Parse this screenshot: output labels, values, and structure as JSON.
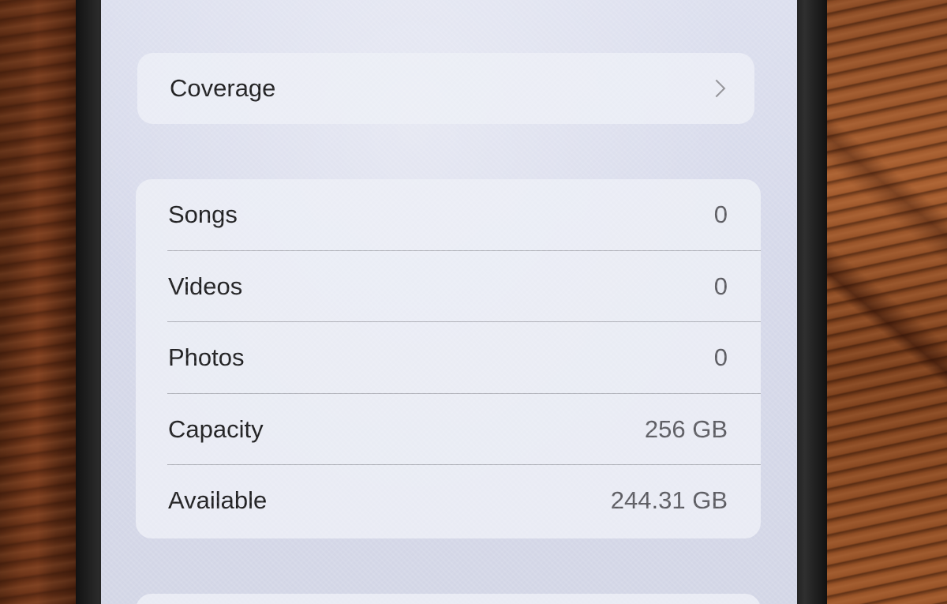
{
  "coverage": {
    "label": "Coverage",
    "chevron_icon": "chevron-right-icon"
  },
  "stats": [
    {
      "label": "Songs",
      "value": "0"
    },
    {
      "label": "Videos",
      "value": "0"
    },
    {
      "label": "Photos",
      "value": "0"
    },
    {
      "label": "Capacity",
      "value": "256 GB"
    },
    {
      "label": "Available",
      "value": "244.31 GB"
    }
  ]
}
